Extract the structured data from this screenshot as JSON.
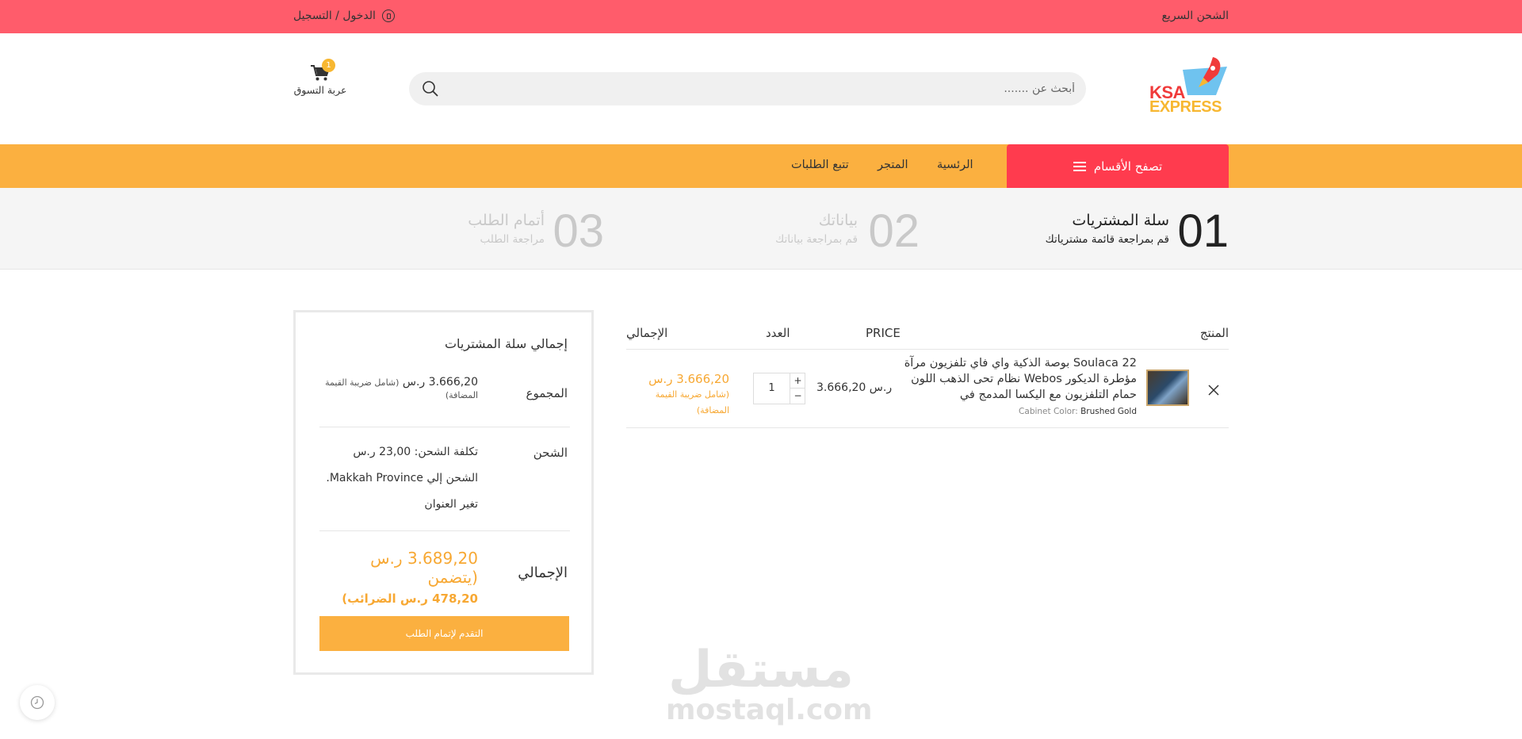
{
  "topbar": {
    "login_label": "الدخول / التسجيل",
    "shipping_label": "الشحن السريع",
    "bg_color": "#ff5c6b"
  },
  "header": {
    "logo_line1": "KSA",
    "logo_line2": "EXPRESS",
    "search_placeholder": "أبحث عن .......",
    "cart_label": "عربة التسوق",
    "cart_count": "1"
  },
  "nav": {
    "browse_label": "تصفح الأقسام",
    "links": [
      "الرئسية",
      "المتجر",
      "تتبع الطلبات"
    ],
    "accent": "#fbb040",
    "browse_color": "#ff3b4e"
  },
  "steps": [
    {
      "num": "01",
      "title": "سلة المشتريات",
      "sub": "قم بمراجعة قائمة مشترياتك",
      "active": true
    },
    {
      "num": "02",
      "title": "بياناتك",
      "sub": "قم بمراجعة بياناتك",
      "active": false
    },
    {
      "num": "03",
      "title": "أتمام الطلب",
      "sub": "مراجعة الطلب",
      "active": false
    }
  ],
  "cart_table": {
    "headers": {
      "product": "المنتج",
      "price": "PRICE",
      "quantity": "العدد",
      "total": "الإجمالي"
    },
    "items": [
      {
        "name": "Soulaca 22 بوصة الذكية واي فاي تلفزيون مرآة مؤطرة الديكور Webos نظام تحى الذهب اللون حمام التلفزيون مع اليكسا المدمج في",
        "meta_key": "Cabinet Color",
        "meta_value": "Brushed Gold",
        "price": "3.666,20 ر.س",
        "quantity": "1",
        "total": "3.666,20 ر.س",
        "total_tax_note": "(شامل ضريبة القيمة المضافة)"
      }
    ]
  },
  "totals": {
    "title": "إجمالي سلة المشتريات",
    "subtotal_label": "المجموع",
    "subtotal_value": "3.666,20 ر.س",
    "subtotal_note": "(شامل ضريبة القيمة المضافة)",
    "shipping_label": "الشحن",
    "shipping_cost": "تكلفة الشحن: 23,00 ر.س",
    "shipping_to": "الشحن إلي Makkah Province.",
    "change_address": "تغير العنوان",
    "grand_label": "الإجمالي",
    "grand_value": "3.689,20 ر.س (يتضمن",
    "grand_tax": "478,20 ر.س الضرائب)",
    "checkout_label": "التقدم لإتمام الطلب"
  },
  "watermark": {
    "arabic": "مستقل",
    "latin": "mostaql.com"
  }
}
